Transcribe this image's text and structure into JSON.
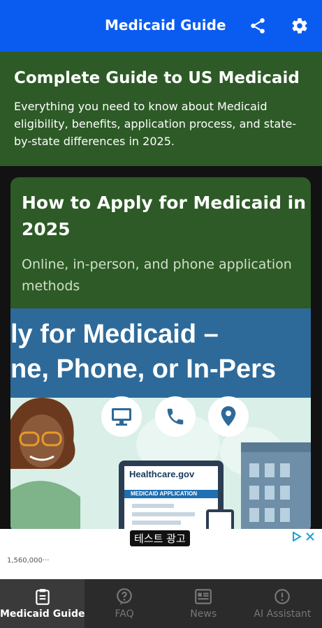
{
  "app_bar": {
    "title": "Medicaid Guide",
    "share_icon": "share-icon",
    "settings_icon": "gear-icon"
  },
  "hero": {
    "title": "Complete Guide to US Medicaid",
    "description": "Everything you need to know about Medicaid eligibility, benefits, application process, and state-by-state differences in 2025."
  },
  "card": {
    "title": "How to Apply for Medicaid in 2025",
    "subtitle": "Online, in-person, and phone application methods",
    "image": {
      "banner_line1": "ly for Medicaid –",
      "banner_line2": "ne, Phone, or In-Pers",
      "icons": [
        "computer-icon",
        "phone-icon",
        "location-icon"
      ],
      "laptop_brand": "Healthcare.gov",
      "laptop_heading": "MEDICAID APPLICATION"
    }
  },
  "ad": {
    "label": "테스트 광고",
    "text": "1,560,000···"
  },
  "bottom_nav": {
    "items": [
      {
        "label": "Medicaid Guide",
        "icon": "clipboard-icon",
        "active": true
      },
      {
        "label": "FAQ",
        "icon": "question-icon",
        "active": false
      },
      {
        "label": "News",
        "icon": "news-icon",
        "active": false
      },
      {
        "label": "AI Assistant",
        "icon": "info-icon",
        "active": false
      }
    ]
  },
  "colors": {
    "app_bar": "#0a5cf0",
    "hero_bg": "#2d5a26",
    "nav_bg": "#2b2b2b"
  }
}
